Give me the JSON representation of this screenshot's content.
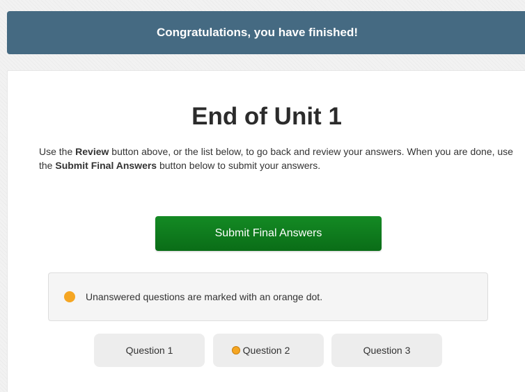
{
  "banner": {
    "text": "Congratulations, you have finished!"
  },
  "main": {
    "title": "End of Unit 1",
    "intro": {
      "part1": "Use the ",
      "review_bold": "Review",
      "part2": " button above, or the list below, to go back and review your answers. When you are done, use the ",
      "submit_bold": "Submit Final Answers",
      "part3": " button below to submit your answers."
    },
    "submit_label": "Submit Final Answers",
    "notice_text": "Unanswered questions are marked with an orange dot.",
    "questions": [
      {
        "label": "Question 1",
        "unanswered": false
      },
      {
        "label": "Question 2",
        "unanswered": true
      },
      {
        "label": "Question 3",
        "unanswered": false
      }
    ]
  },
  "colors": {
    "banner": "#456a82",
    "submit_button": "#0f7d1e",
    "unanswered_dot": "#f5a623"
  }
}
